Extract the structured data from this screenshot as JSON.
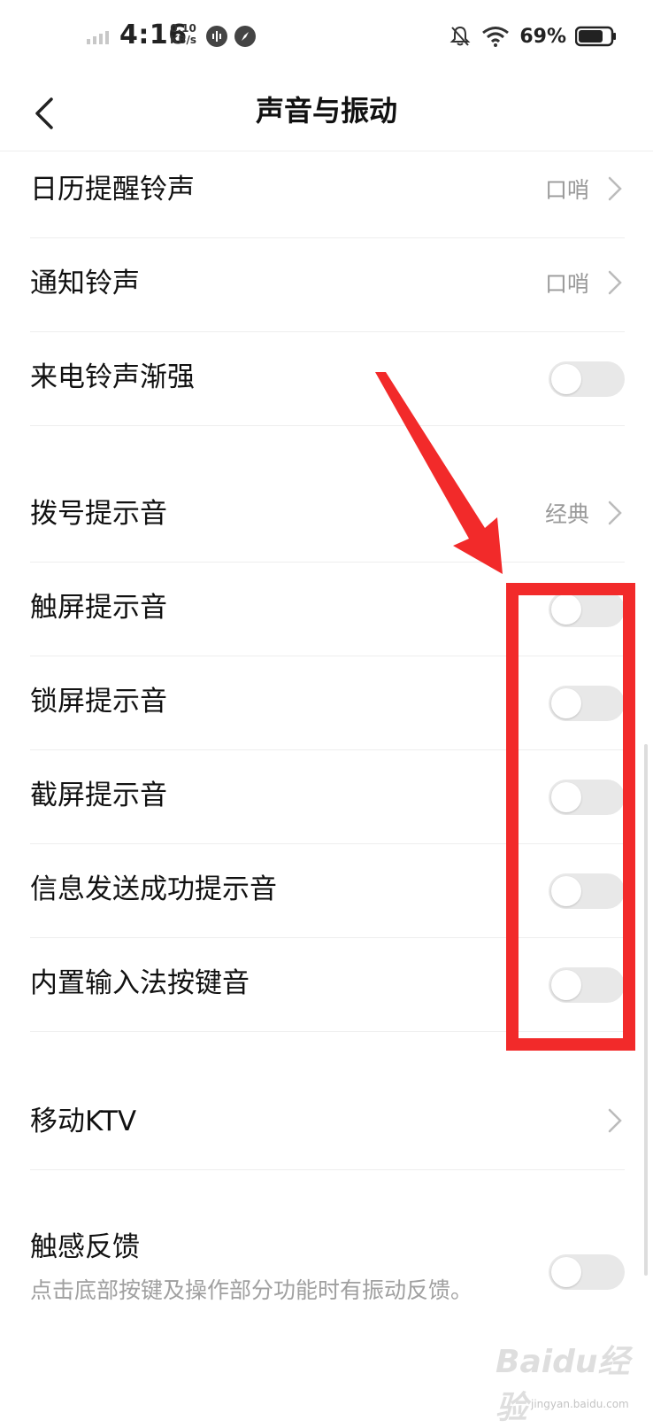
{
  "status_bar": {
    "time": "4:16",
    "speed_value": "0.10",
    "speed_unit": "KB/s",
    "battery": "69%"
  },
  "header": {
    "title": "声音与振动"
  },
  "rows": [
    {
      "label": "日历提醒铃声",
      "value": "口哨"
    },
    {
      "label": "通知铃声",
      "value": "口哨"
    },
    {
      "label": "来电铃声渐强"
    },
    {
      "label": "拨号提示音",
      "value": "经典"
    },
    {
      "label": "触屏提示音"
    },
    {
      "label": "锁屏提示音"
    },
    {
      "label": "截屏提示音"
    },
    {
      "label": "信息发送成功提示音"
    },
    {
      "label": "内置输入法按键音"
    },
    {
      "label": "移动KTV"
    },
    {
      "label": "触感反馈",
      "description": "点击底部按键及操作部分功能时有振动反馈。"
    }
  ],
  "toggles": {
    "incoming_fade": false,
    "touch_sound": false,
    "lock_sound": false,
    "screenshot_sound": false,
    "message_sent_sound": false,
    "keyboard_sound": false,
    "haptic_feedback": false
  },
  "watermark": {
    "brand": "Baidu经验",
    "url": "jingyan.baidu.com"
  },
  "colors": {
    "annotation_red": "#f22a2a",
    "toggle_off": "#e8e8e8",
    "secondary_text": "#9a9a9a"
  }
}
